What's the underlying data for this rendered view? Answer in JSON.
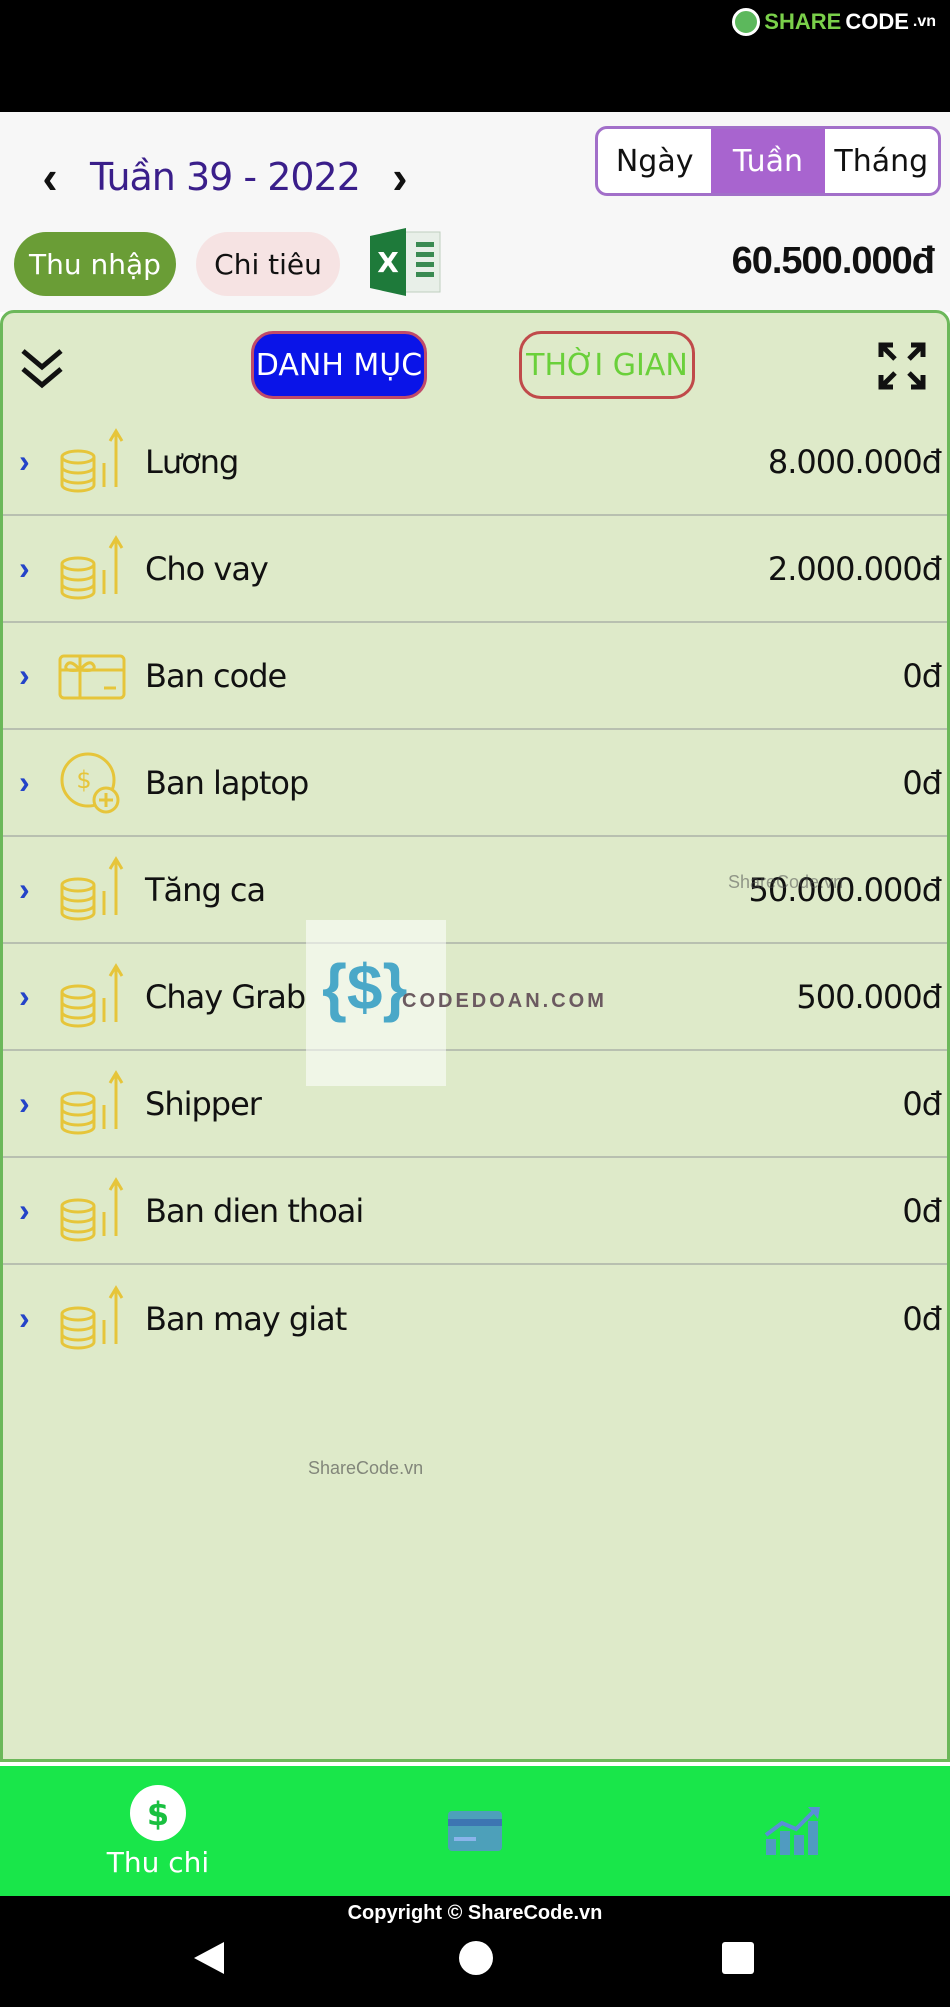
{
  "brand": {
    "text_prefix": "SHARE",
    "text_suffix": "CODE",
    "text_domain": ".vn"
  },
  "header": {
    "prev": "‹",
    "next": "›",
    "week_title": "Tuần 39 - 2022",
    "segments": [
      {
        "label": "Ngày",
        "active": false
      },
      {
        "label": "Tuần",
        "active": true
      },
      {
        "label": "Tháng",
        "active": false
      }
    ],
    "income_label": "Thu nhập",
    "expense_label": "Chi tiêu",
    "total": "60.500.000đ"
  },
  "panel": {
    "category_btn": "DANH MỤC",
    "time_btn": "THỜI GIAN",
    "items": [
      {
        "name": "Lương",
        "amount": "8.000.000đ",
        "icon": "coins-up-icon"
      },
      {
        "name": "Cho vay",
        "amount": "2.000.000đ",
        "icon": "coins-up-icon"
      },
      {
        "name": "Ban code",
        "amount": "0đ",
        "icon": "gift-card-icon"
      },
      {
        "name": "Ban laptop",
        "amount": "0đ",
        "icon": "dollar-plus-icon"
      },
      {
        "name": "Tăng ca",
        "amount": "50.000.000đ",
        "icon": "coins-up-icon"
      },
      {
        "name": "Chay Grab",
        "amount": "500.000đ",
        "icon": "coins-up-icon"
      },
      {
        "name": "Shipper",
        "amount": "0đ",
        "icon": "coins-up-icon"
      },
      {
        "name": "Ban dien thoai",
        "amount": "0đ",
        "icon": "coins-up-icon"
      },
      {
        "name": "Ban may giat",
        "amount": "0đ",
        "icon": "coins-up-icon"
      }
    ]
  },
  "watermarks": {
    "codedoan": "CODEDOAN.COM",
    "sharecode_a": "ShareCode.vn",
    "sharecode_b": "ShareCode.vn"
  },
  "bottom_nav": {
    "thu_chi": "Thu chi"
  },
  "footer": {
    "copyright": "Copyright © ShareCode.vn"
  },
  "colors": {
    "accent": "#a864cf",
    "income": "#6a9d36",
    "nav": "#19e64a",
    "panel": "#deeac9"
  }
}
